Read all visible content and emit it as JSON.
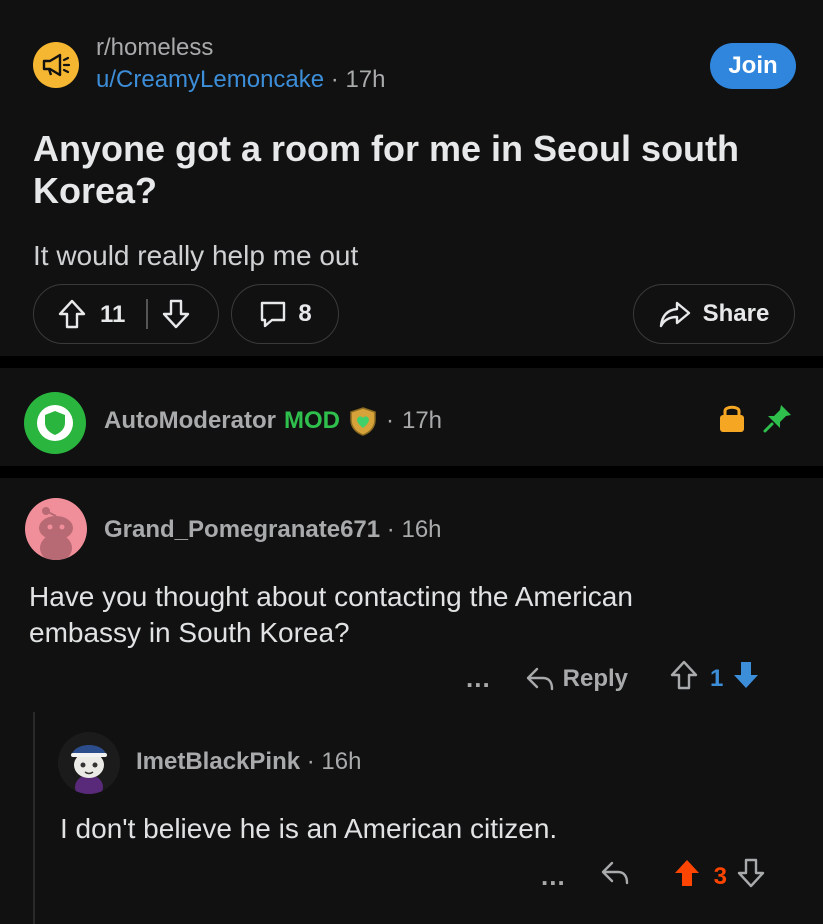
{
  "post": {
    "subreddit": "r/homeless",
    "author": "u/CreamyLemoncake",
    "age": "17h",
    "join_label": "Join",
    "title": "Anyone got a room for me in Seoul south Korea?",
    "body": "It would really help me out",
    "upvotes": "11",
    "comments": "8",
    "share_label": "Share"
  },
  "automod": {
    "name": "AutoModerator",
    "tag": "MOD",
    "age": "17h"
  },
  "comment1": {
    "user": "Grand_Pomegranate671",
    "age": "16h",
    "text": "Have you thought about contacting the American embassy in South Korea?",
    "more": "...",
    "reply_label": "Reply",
    "score": "1"
  },
  "comment2": {
    "user": "ImetBlackPink",
    "age": "16h",
    "text": "I don't believe he is an American citizen.",
    "more": "...",
    "score": "3"
  },
  "colors": {
    "upvote_active": "#ff4500",
    "downvote_active": "#3d8ed9",
    "join": "#2f86dc",
    "mod_green": "#2fbf4d"
  }
}
